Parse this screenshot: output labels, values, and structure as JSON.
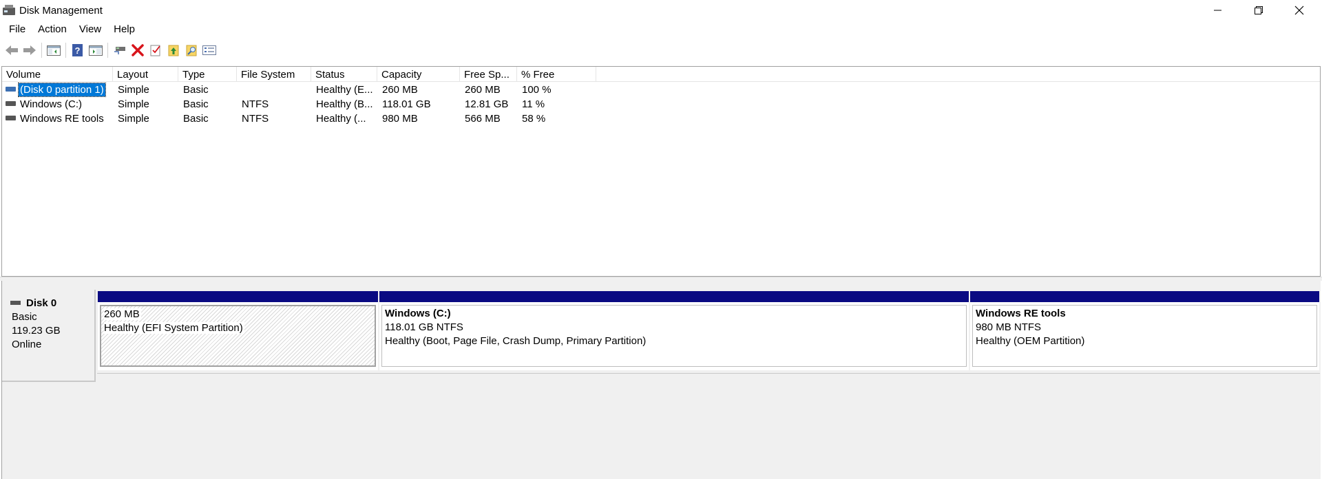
{
  "window": {
    "title": "Disk Management"
  },
  "menu": [
    "File",
    "Action",
    "View",
    "Help"
  ],
  "toolbar_icons": [
    "back-icon",
    "forward-icon",
    "show-hide-console-tree-icon",
    "help-icon",
    "properties-icon",
    "connect-disk-icon",
    "delete-icon",
    "check-icon",
    "folder-up-icon",
    "folder-search-icon",
    "list-icon"
  ],
  "volumes": {
    "columns": [
      "Volume",
      "Layout",
      "Type",
      "File System",
      "Status",
      "Capacity",
      "Free Sp...",
      "% Free"
    ],
    "rows": [
      {
        "volume": "(Disk 0 partition 1)",
        "layout": "Simple",
        "type": "Basic",
        "fs": "",
        "status": "Healthy (E...",
        "capacity": "260 MB",
        "free": "260 MB",
        "pct": "100 %",
        "selected": true
      },
      {
        "volume": "Windows (C:)",
        "layout": "Simple",
        "type": "Basic",
        "fs": "NTFS",
        "status": "Healthy (B...",
        "capacity": "118.01 GB",
        "free": "12.81 GB",
        "pct": "11 %",
        "selected": false
      },
      {
        "volume": "Windows RE tools",
        "layout": "Simple",
        "type": "Basic",
        "fs": "NTFS",
        "status": "Healthy (...",
        "capacity": "980 MB",
        "free": "566 MB",
        "pct": "58 %",
        "selected": false
      }
    ]
  },
  "disk": {
    "name": "Disk 0",
    "type": "Basic",
    "size": "119.23 GB",
    "state": "Online"
  },
  "partitions": [
    {
      "name": "",
      "size": "260 MB",
      "status": "Healthy (EFI System Partition)"
    },
    {
      "name": "Windows  (C:)",
      "size": "118.01 GB NTFS",
      "status": "Healthy (Boot, Page File, Crash Dump, Primary Partition)"
    },
    {
      "name": "Windows RE tools",
      "size": "980 MB NTFS",
      "status": "Healthy (OEM Partition)"
    }
  ],
  "colors": {
    "selection": "#0078d7",
    "partition_bar": "#0a0a82"
  }
}
